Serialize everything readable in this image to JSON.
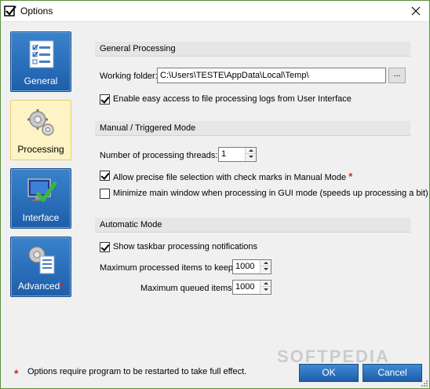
{
  "window": {
    "title": "Options"
  },
  "sidebar": {
    "items": [
      {
        "label": "General",
        "required": false
      },
      {
        "label": "Processing",
        "required": false
      },
      {
        "label": "Interface",
        "required": false
      },
      {
        "label": "Advanced",
        "required": true
      }
    ],
    "required_marker": "*"
  },
  "general": {
    "header": "General Processing",
    "working_folder_label": "Working folder:",
    "working_folder_value": "C:\\Users\\TESTE\\AppData\\Local\\Temp\\",
    "browse_label": "...",
    "easy_access_label": "Enable easy access to file processing logs from User Interface",
    "easy_access_checked": true
  },
  "manual": {
    "header": "Manual / Triggered Mode",
    "threads_label": "Number of processing threads:",
    "threads_value": "1",
    "precise_label": "Allow precise file selection with check marks in Manual Mode",
    "precise_checked": true,
    "precise_marker": "*",
    "minimize_label": "Minimize main window when processing in GUI mode (speeds up processing a bit)",
    "minimize_checked": false
  },
  "automatic": {
    "header": "Automatic Mode",
    "taskbar_label": "Show taskbar processing notifications",
    "taskbar_checked": true,
    "max_keep_label": "Maximum processed items to keep:",
    "max_keep_value": "1000",
    "max_queue_label": "Maximum queued items:",
    "max_queue_value": "1000"
  },
  "footer": {
    "marker": "*",
    "note": "Options require program to be restarted to take full effect.",
    "ok_label": "OK",
    "cancel_label": "Cancel",
    "watermark": "SOFTPEDIA"
  },
  "colors": {
    "accent": "#1e5ea9",
    "frame": "#5a8f3f",
    "selected_bg": "#fdf3c4",
    "required": "#e21d1d"
  }
}
